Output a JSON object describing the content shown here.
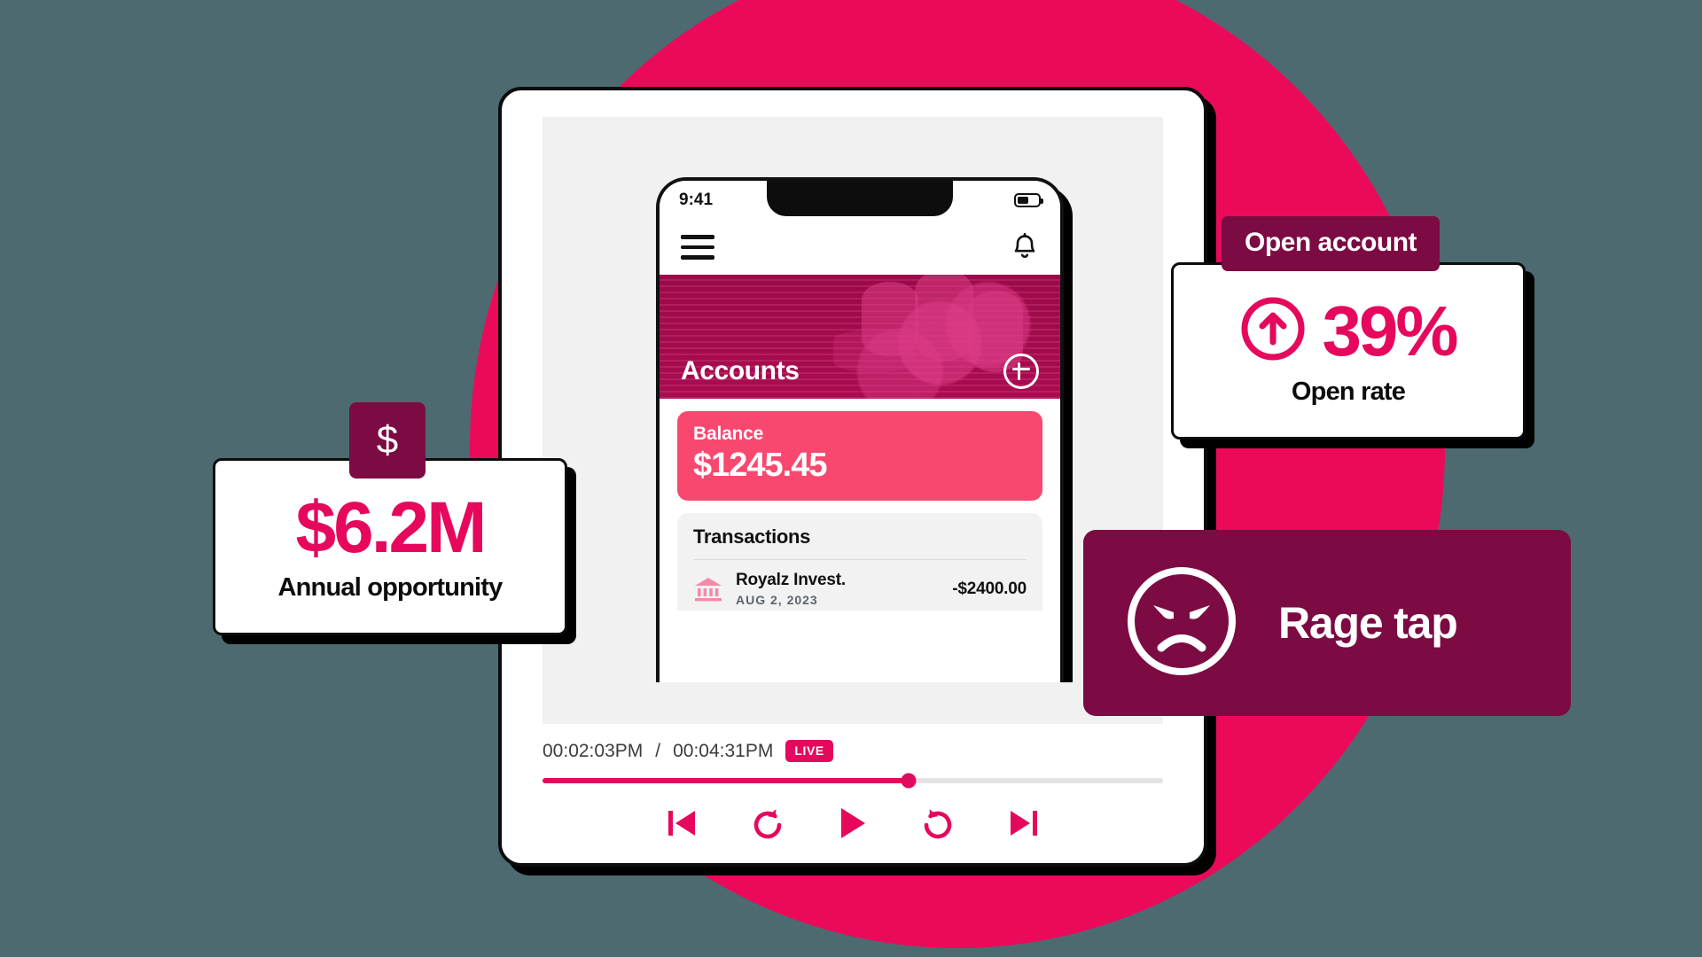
{
  "theme": {
    "background": "#4d6a70",
    "circle": "#eb0a5a",
    "accent_pink": "#e5085d",
    "accent_deep": "#7b0b42",
    "balance_card": "#f9486f",
    "hero": "#a80c50"
  },
  "phone": {
    "status_time": "9:41",
    "battery_icon": "battery-icon",
    "menu_icon": "hamburger-menu-icon",
    "bell_icon": "bell-icon",
    "hero_title": "Accounts",
    "add_icon": "plus-circle-icon",
    "balance": {
      "label": "Balance",
      "value": "$1245.45"
    },
    "transactions": {
      "heading": "Transactions",
      "rows": [
        {
          "icon": "bank-icon",
          "name": "Royalz Invest.",
          "date": "AUG 2, 2023",
          "amount": "-$2400.00"
        }
      ]
    }
  },
  "player": {
    "current_time": "00:02:03PM",
    "separator": "/",
    "total_time": "00:04:31PM",
    "live_badge": "LIVE",
    "progress_percent": 59,
    "controls": [
      {
        "name": "skip-back-icon",
        "label": "Skip back"
      },
      {
        "name": "rewind-icon",
        "label": "Rewind"
      },
      {
        "name": "play-icon",
        "label": "Play"
      },
      {
        "name": "fast-forward-icon",
        "label": "Fast forward"
      },
      {
        "name": "skip-forward-icon",
        "label": "Skip forward"
      }
    ]
  },
  "cards": {
    "money": {
      "chip_icon": "dollar-sign-icon",
      "chip_label": "$",
      "value": "$6.2M",
      "caption": "Annual opportunity"
    },
    "open_rate": {
      "chip_label": "Open account",
      "icon": "arrow-up-circle-icon",
      "value": "39%",
      "caption": "Open rate"
    },
    "rage_tap": {
      "icon": "angry-face-icon",
      "label": "Rage tap"
    }
  }
}
